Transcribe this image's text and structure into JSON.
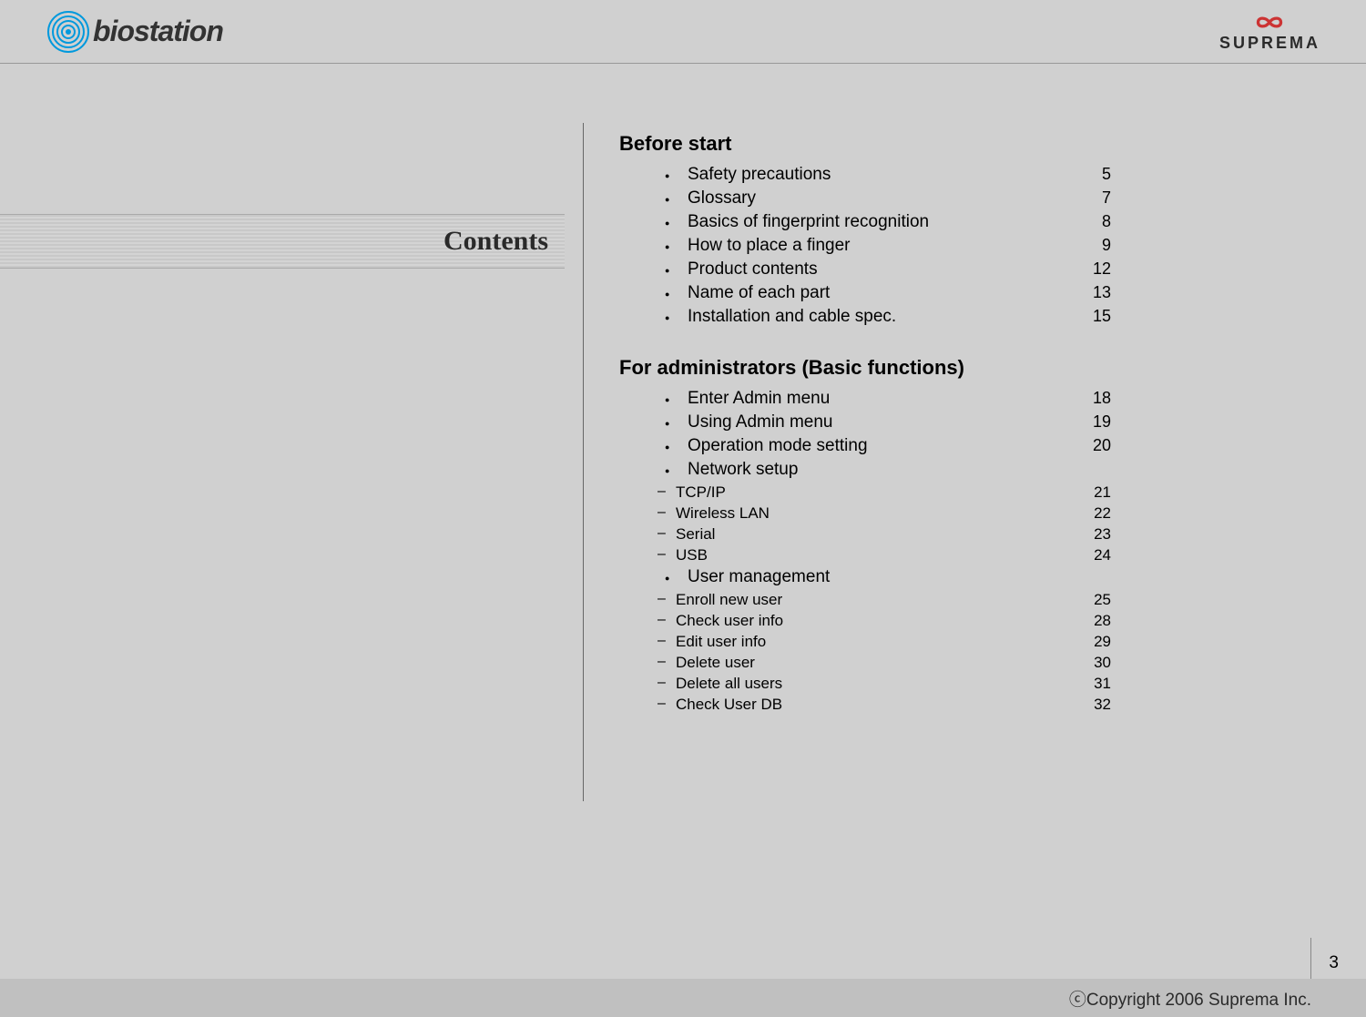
{
  "header": {
    "logo_left": "biostation",
    "logo_right": "SUPREMA"
  },
  "left": {
    "title": "Contents"
  },
  "toc": {
    "sections": [
      {
        "heading": "Before start",
        "items": [
          {
            "label": "Safety precautions",
            "page": "5"
          },
          {
            "label": "Glossary",
            "page": "7"
          },
          {
            "label": "Basics of fingerprint recognition",
            "page": "8"
          },
          {
            "label": "How to place a finger",
            "page": "9"
          },
          {
            "label": "Product contents",
            "page": "12"
          },
          {
            "label": "Name of each part",
            "page": "13"
          },
          {
            "label": "Installation and cable spec.",
            "page": "15"
          }
        ]
      },
      {
        "heading": "For administrators (Basic functions)",
        "items": [
          {
            "label": "Enter Admin menu",
            "page": "18"
          },
          {
            "label": "Using Admin menu",
            "page": "19"
          },
          {
            "label": "Operation mode setting",
            "page": "20"
          },
          {
            "label": "Network setup",
            "page": "",
            "sub": [
              {
                "label": "TCP/IP",
                "page": "21"
              },
              {
                "label": "Wireless LAN",
                "page": "22"
              },
              {
                "label": "Serial",
                "page": "23"
              },
              {
                "label": "USB",
                "page": "24"
              }
            ]
          },
          {
            "label": "User management",
            "page": "",
            "sub": [
              {
                "label": "Enroll new user",
                "page": "25"
              },
              {
                "label": "Check user info",
                "page": "28"
              },
              {
                "label": "Edit user info",
                "page": "29"
              },
              {
                "label": "Delete user",
                "page": "30"
              },
              {
                "label": "Delete all users",
                "page": "31"
              },
              {
                "label": "Check User DB",
                "page": "32"
              }
            ]
          }
        ]
      }
    ]
  },
  "footer": {
    "copyright": "ⓒCopyright 2006 Suprema Inc.",
    "page_number": "3"
  }
}
